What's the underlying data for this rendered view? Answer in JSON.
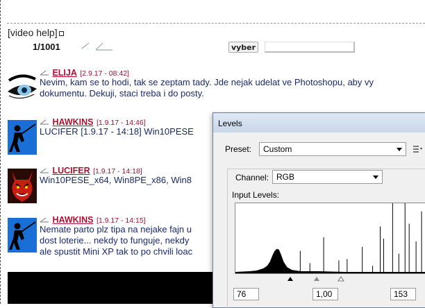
{
  "forum": {
    "title": "[video help]",
    "page_count": "1/1001",
    "vyber_label": "vyber"
  },
  "posts": [
    {
      "author": "ELIJA",
      "stamp": "[2.9.17 - 08:42]",
      "avatar": "eye-icon",
      "lines": [
        "Nevim, kam se to hodi, tak se zeptam tady. Jde nejak udelat ve Photoshopu, aby vy",
        "dokumentu. Dekuji, staci treba i do posty."
      ]
    },
    {
      "author": "HAWKINS",
      "stamp": "[1.9.17 - 14:46]",
      "avatar": "fencer-icon",
      "lines": [
        "LUCIFER [1.9.17 - 14:18] Win10PESE"
      ]
    },
    {
      "author": "LUCIFER",
      "stamp": "[1.9.17 - 14:18]",
      "avatar": "devil-icon",
      "lines": [
        "Win10PESE_x64, Win8PE_x86, Win8"
      ]
    },
    {
      "author": "HAWKINS",
      "stamp": "[1.9.17 - 14:15]",
      "avatar": "fencer-icon",
      "lines": [
        "Nemate parto plz tipa na nejake fajn u",
        "dost loterie... nekdy to funguje, nekdy",
        "ale spustit Mini XP tak to po chvili loac"
      ]
    }
  ],
  "levels": {
    "title": "Levels",
    "preset_label": "Preset:",
    "preset_value": "Custom",
    "channel_label": "Channel:",
    "channel_value": "RGB",
    "input_levels_label": "Input Levels:",
    "input_black": "76",
    "input_gamma": "1,00",
    "input_white": "153"
  },
  "colors": {
    "author": "#b01030",
    "body_text": "#1a2a6e",
    "dialog_title": "#c9d7ea"
  }
}
